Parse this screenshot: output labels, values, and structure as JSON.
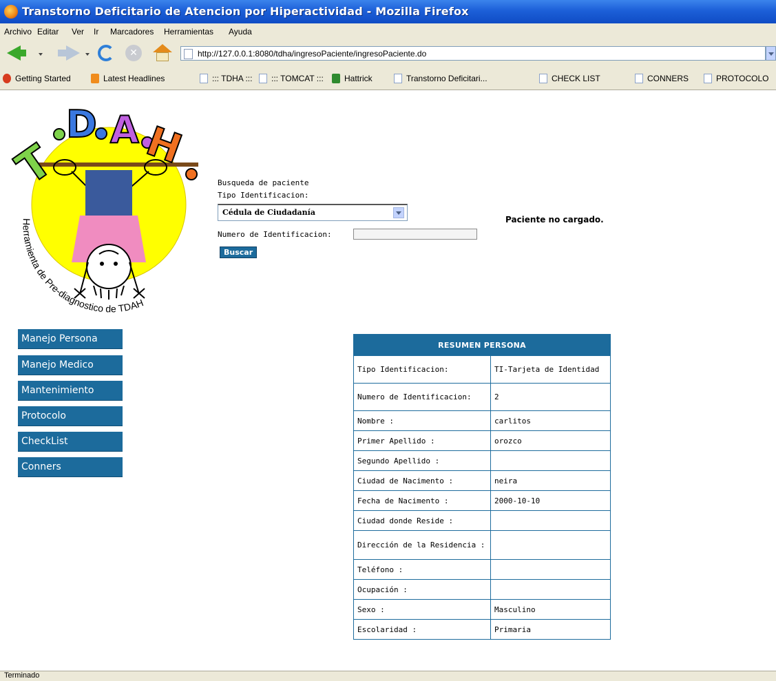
{
  "window": {
    "title": "Transtorno Deficitario de Atencion por Hiperactividad - Mozilla Firefox"
  },
  "menu": [
    "Archivo",
    "Editar",
    "Ver",
    "Ir",
    "Marcadores",
    "Herramientas",
    "Ayuda"
  ],
  "address": {
    "url": "http://127.0.0.1:8080/tdha/ingresoPaciente/ingresoPaciente.do"
  },
  "bookmarks": [
    "Getting Started",
    "Latest Headlines",
    "::: TDHA :::",
    "::: TOMCAT :::",
    "Hattrick",
    "Transtorno Deficitari...",
    "CHECK LIST",
    "CONNERS",
    "PROTOCOLO"
  ],
  "logo": {
    "letters": "T.D.A.H.",
    "tagline": "Herramienta de Pre-diagnostico de TDAH"
  },
  "search": {
    "heading": "Busqueda de paciente",
    "tipo_label": "Tipo Identificacion:",
    "tipo_value": "Cédula de Ciudadanía",
    "numero_label": "Numero de Identificacion:",
    "button": "Buscar"
  },
  "status_message": "Paciente no cargado.",
  "sidebar": [
    "Manejo Persona",
    "Manejo Medico",
    "Mantenimiento",
    "Protocolo",
    "CheckList",
    "Conners"
  ],
  "resumen": {
    "title": "RESUMEN PERSONA",
    "rows": [
      {
        "label": "Tipo Identificacion:",
        "value": "TI-Tarjeta de Identidad"
      },
      {
        "label": "Numero de Identificacion:",
        "value": "2"
      },
      {
        "label": "Nombre :",
        "value": "carlitos"
      },
      {
        "label": "Primer Apellido :",
        "value": "orozco"
      },
      {
        "label": "Segundo Apellido :",
        "value": ""
      },
      {
        "label": "Ciudad de Nacimento :",
        "value": "neira"
      },
      {
        "label": "Fecha de Nacimento :",
        "value": "2000-10-10"
      },
      {
        "label": "Ciudad donde Reside :",
        "value": ""
      },
      {
        "label": "Dirección de la Residencia :",
        "value": ""
      },
      {
        "label": "Teléfono :",
        "value": ""
      },
      {
        "label": "Ocupación :",
        "value": ""
      },
      {
        "label": "Sexo :",
        "value": "Masculino"
      },
      {
        "label": "Escolaridad :",
        "value": "Primaria"
      }
    ]
  },
  "statusbar": {
    "text": "Terminado"
  },
  "colors": {
    "accent": "#1c6b9c",
    "titlebar": "#0f4cc4",
    "chrome": "#ece9d8",
    "logo_circle": "#ffff00"
  }
}
